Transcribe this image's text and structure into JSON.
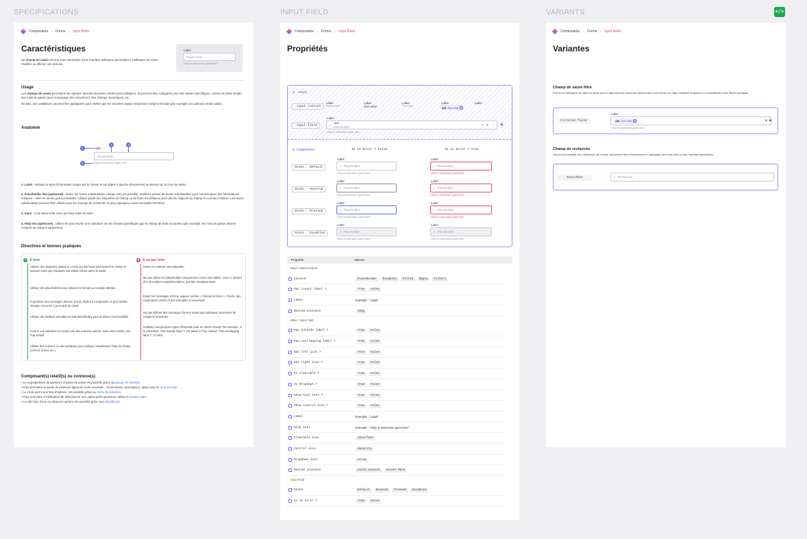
{
  "columns": {
    "spec": "SPECIFICATIONS",
    "input": "INPUT FIELD",
    "variants": "VARIANTS"
  },
  "breadcrumb": {
    "a": "Composants",
    "sep": "→",
    "b": "Forms",
    "c": "Input fields"
  },
  "spec": {
    "title": "Caractéristiques",
    "intro_bold": "champ de saisie",
    "intro_pre": "Un ",
    "intro_post": " est une zone interactive d'une interface utilisateur permettant à l'utilisateur de saisir, modifier ou afficher une donnée.",
    "preview": {
      "label": "Label",
      "placeholder": "Placeholder",
      "help": "Help or instruction goes here"
    },
    "usage_title": "Usage",
    "usage_bold": "champs de saisie",
    "usage_pre": "Les ",
    "usage_post": " permettent de capturer diverses données entrées par l'utilisateur. Ils peuvent être configurés pour des saisies spécifiques, comme du texte simple, des mots de passe (avec masquage des caractères), des champs numériques, etc.",
    "usage_p2": "De plus, des validations peuvent être appliquées pour vérifier que les données saisies respectent certains formats (par exemple une adresse email valide).",
    "anatomy_title": "Anatomie",
    "anatomy": {
      "n1": "1",
      "n2": "2",
      "n3": "3",
      "n4": "4",
      "label": "Label",
      "placeholder": "Placeholder",
      "help": "Help or instruction goes here"
    },
    "defs": [
      {
        "b": "1. Label",
        "t": " : Indiquer le type d'information requis par le champ et est aligné à gauche directement au-dessus de la zone de saisie."
      },
      {
        "b": "2. Placeholder text (optionnel)",
        "t": " : Évitez les textes substituables lorsque cela est possible. N'utilisez jamais de textes substituables pour communiquer des informations critiques – elles ne seront pas accessibles. Utilisez plutôt des étiquettes de champ ou du texte d'assistance pour décrire l'objectif du champ et comment l'utiliser. Les textes substituables peuvent être utilisés pour les champs de recherche ou pour quelques courts exemples d'entrées."
      },
      {
        "b": "3. Input",
        "t": " : C'est dans cette zone qu'il faut saisir du texte."
      },
      {
        "b": "4. Help text (optionnel)",
        "t": " : Utilisez-le pour fournir une indication sur les formats spécifiques que le champ de texte acceptera (par exemple, les mots de passe doivent contenir au moins 8 caractères)."
      }
    ],
    "guide_title": "Directives et bonnes pratiques",
    "do_title": "À faire",
    "dont_title": "À ne pas faire",
    "do": [
      "Utilisez des étiquettes claires et concis qui décrivent précisément le champ et assurez-vous que l'étiquette soit visible même après la saisie.",
      "Utilisez des placeholders pour indiquer le format ou exemple attendu.",
      "Fournissez des messages d'erreur précis, faciles à comprendre et près du/des champs concerné à pour plus de clarté.",
      "Utilisez des attributs aria-label et aria-describedby pour améliorer l'accessibilité.",
      "Fournir une validation en temps réel des données saisies, mais sans rendre cela trop intrusif.",
      "Utiliser des couleurs ou des symboles pour indiquer visuellement l'état du champ (correct, erreur, etc.)."
    ],
    "dont": [
      "Évitez les champs sans étiquette.",
      "Ne pas utiliser les placeholders uniquement comme des labels. Ceux-ci doivent être des indices supplémentaires, pas des remplacements.",
      "Évitez les messages d'erreur vagues comme « Champ incorrect ». Fournir des explications claires et des exemples si nécessaire.",
      "Ne pas afficher des messages d'erreur avant que l'utilisateur ait terminé de remplir le formulaire.",
      "N'utilisez pas plusieurs types d'étiquette pour un même champ! Par exemple, si le paramètre \"Has outside label ?\" est passé à True, laissez \"Has overlapping label ?\" à False."
    ],
    "related_title": "Composant(s) relatif(s) ou connexe(s)",
    "related": [
      {
        "t": "• Le regroupement de plusieurs champs de saisie est possible grâce au ",
        "l": "groupe de champs",
        "e": "."
      },
      {
        "t": "• Pour permettre la saisie de plusieurs lignes de texte (exemple : commentaire, description), optez pour la ",
        "l": "zone de texte",
        "e": "."
      },
      {
        "t": "• Le choix parmi une liste d'options, est possible grâce au ",
        "l": "menu de sélection",
        "e": "."
      },
      {
        "t": "• Pour permettre à l'utilisateur de sélectionner une option parmi plusieurs, utiliser le ",
        "l": "bouton radio",
        "e": "."
      },
      {
        "t": "• La sélection d'une ou plusieurs options est possible grâce aux ",
        "l": "checkboxes",
        "e": "."
      }
    ]
  },
  "props": {
    "title": "Propriétés",
    "base": {
      "tag": ".base",
      "ic": ".input content",
      "if": ".input field",
      "label": "Label",
      "placeholder": "Placeholder",
      "text_value": "Text value",
      "text_input": "Text input",
      "chip_av": "AM",
      "chip": "Text chip",
      "help": "Help or instruction goes here"
    },
    "component": {
      "tag": "Component",
      "col1": "Is in Error ? False",
      "col2": "Is in Error ? True",
      "states": [
        "State : Default",
        "State : Hovered",
        "State : Pressed",
        "State : Disabled"
      ],
      "label": "Label",
      "placeholder": "Placeholder",
      "help": "Help or instruction goes here"
    },
    "table_head": {
      "k": "Propriété",
      "v": "Valeurs"
    },
    "sections": [
      {
        "title": "Base / Input Content",
        "rows": [
          {
            "k": "Content",
            "chips": [
              "Placeholder",
              "Disabled",
              "Filled",
              "Empty",
              "Filters"
            ]
          },
          {
            "k": "Has insert label ?",
            "chips": [
              "True",
              "False"
            ]
          },
          {
            "k": "Label",
            "text": "Exemple : \"Label\""
          },
          {
            "k": "Nested instance",
            "chips": [
              "Chip"
            ]
          }
        ]
      },
      {
        "title": "Base / Input Field",
        "rows": [
          {
            "k": "Has outside label ?",
            "chips": [
              "True",
              "False"
            ]
          },
          {
            "k": "Has overlapping label ?",
            "chips": [
              "True",
              "False"
            ]
          },
          {
            "k": "Has left icon ?",
            "chips": [
              "True",
              "False"
            ]
          },
          {
            "k": "Has right icon ?",
            "chips": [
              "True",
              "False"
            ]
          },
          {
            "k": "Is clearable ?",
            "chips": [
              "True",
              "False"
            ]
          },
          {
            "k": "Is Dropdown ?",
            "chips": [
              "True",
              "False"
            ]
          },
          {
            "k": "Show hint text ?",
            "chips": [
              "True",
              "False"
            ]
          },
          {
            "k": "Show control icon ?",
            "chips": [
              "True",
              "False"
            ]
          },
          {
            "k": "Label",
            "text": "Exemple : \"Label\""
          },
          {
            "k": "Help text",
            "text": "Exemple : \"Help or instruction goes here\""
          },
          {
            "k": "Clearable icon",
            "chips": [
              "Interface"
            ]
          },
          {
            "k": "Control icon",
            "chips": [
              "Security"
            ]
          },
          {
            "k": "Dropdown icon",
            "chips": [
              "Arrow"
            ]
          },
          {
            "k": "Nested instance",
            "chips": [
              "Field Content",
              "Select Menu"
            ]
          }
        ]
      },
      {
        "title": "Input Field",
        "rows": [
          {
            "k": "State",
            "chips": [
              "Default",
              "Hovered",
              "Pressed",
              "Disabled"
            ]
          },
          {
            "k": "Is in error ?",
            "chips": [
              "True",
              "False"
            ]
          }
        ]
      }
    ]
  },
  "variants": {
    "title": "Variantes",
    "filtered_title": "Champ de saisie filtré",
    "filtered_desc": "Permet à l'utilisateur de saisir du texte tout en affichant des éléments sélectionnés sous forme de chips, facilitant la gestion et la visualisation des filtres appliqués.",
    "filtered_tag": "Filtered field",
    "filtered_label": "Label",
    "chip_av": "AM",
    "chip": "Text chip",
    "help": "Help or instruction goes here",
    "search_title": "Champ de recherche",
    "search_desc": "Donne la possibilité aux utilisateurs de trouver rapidement des informations en saisissant des mots-clés ou des requêtes spécifiques.",
    "search_tag": "Searchbar",
    "search_placeholder": "Recherche..."
  },
  "colors": {
    "accent": "#7b61ff",
    "error": "#e2456b",
    "success": "#1fa855",
    "dev_badge": "#1fa855"
  }
}
